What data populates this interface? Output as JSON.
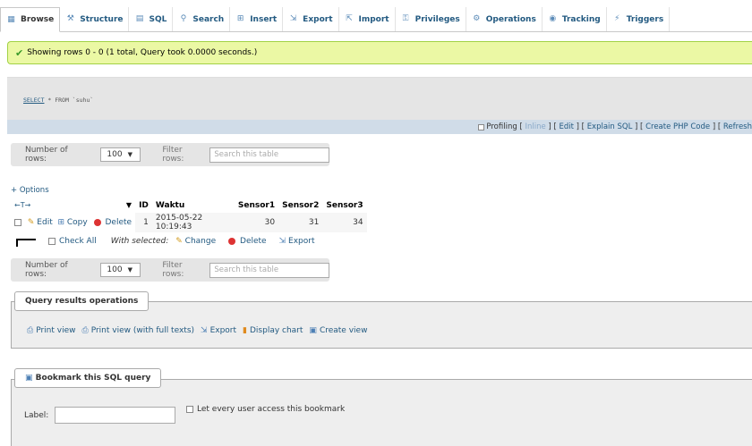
{
  "tabs": [
    {
      "label": "Browse",
      "icon": "▦",
      "icon_name": "table-icon"
    },
    {
      "label": "Structure",
      "icon": "⚒",
      "icon_name": "structure-icon"
    },
    {
      "label": "SQL",
      "icon": "▤",
      "icon_name": "sql-icon"
    },
    {
      "label": "Search",
      "icon": "⚲",
      "icon_name": "search-icon"
    },
    {
      "label": "Insert",
      "icon": "⊞",
      "icon_name": "insert-icon"
    },
    {
      "label": "Export",
      "icon": "⇲",
      "icon_name": "export-icon"
    },
    {
      "label": "Import",
      "icon": "⇱",
      "icon_name": "import-icon"
    },
    {
      "label": "Privileges",
      "icon": "⚿",
      "icon_name": "privileges-icon"
    },
    {
      "label": "Operations",
      "icon": "⚙",
      "icon_name": "operations-icon"
    },
    {
      "label": "Tracking",
      "icon": "◉",
      "icon_name": "tracking-icon"
    },
    {
      "label": "Triggers",
      "icon": "⚡",
      "icon_name": "triggers-icon"
    }
  ],
  "message": "Showing rows 0 - 0 (1 total, Query took 0.0000 seconds.)",
  "sql": {
    "keyword": "SELECT",
    "rest": " * FROM `suhu`"
  },
  "toolbar": {
    "profiling": "Profiling",
    "sep": " [",
    "inline": "Inline",
    "edit": "Edit",
    "explain": "Explain SQL",
    "php": "Create PHP Code",
    "refresh": "Refresh"
  },
  "nav": {
    "rows_label": "Number of rows:",
    "rows_value": "100",
    "filter_label": "Filter rows:",
    "filter_placeholder": "Search this table"
  },
  "options_label": "+ Options",
  "arrows": "←T→",
  "table": {
    "sort_glyph": "▼",
    "columns": [
      "ID",
      "Waktu",
      "Sensor1",
      "Sensor2",
      "Sensor3"
    ],
    "rows": [
      {
        "edit": "Edit",
        "copy": "Copy",
        "delete": "Delete",
        "id": "1",
        "waktu": "2015-05-22 10:19:43",
        "s1": "30",
        "s2": "31",
        "s3": "34"
      }
    ]
  },
  "with_selected": {
    "check_all": "Check All",
    "label": "With selected:",
    "change": "Change",
    "delete": "Delete",
    "export": "Export"
  },
  "query_ops": {
    "legend": "Query results operations",
    "print": "Print view",
    "print_full": "Print view (with full texts)",
    "export": "Export",
    "chart": "Display chart",
    "view": "Create view"
  },
  "bookmark": {
    "legend": "Bookmark this SQL query",
    "label": "Label:",
    "all_users": "Let every user access this bookmark"
  },
  "colors": {
    "accent": "#235a81",
    "success_bg": "#ebf8a4",
    "success_border": "#a2d246"
  }
}
